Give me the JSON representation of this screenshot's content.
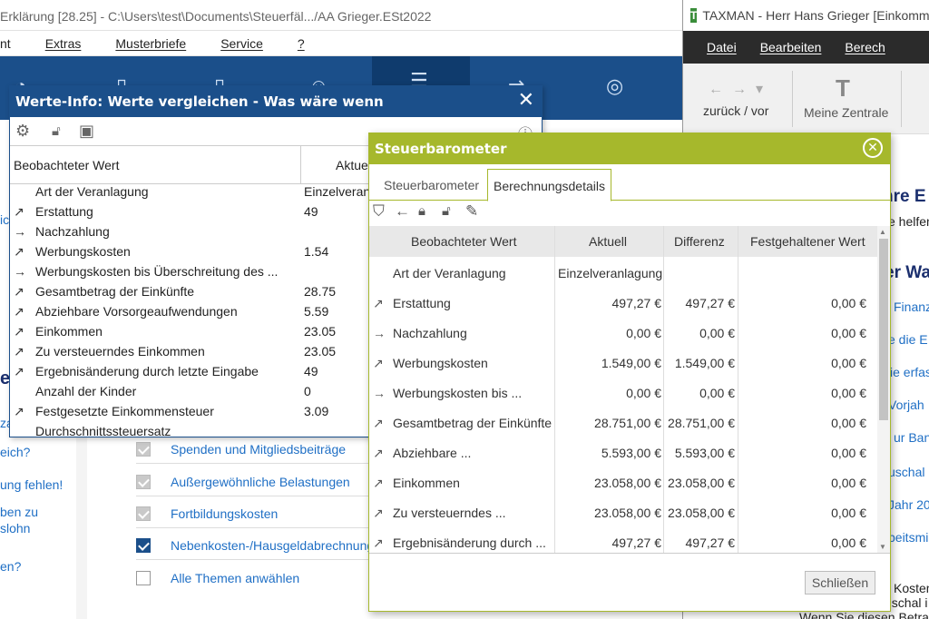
{
  "backwin": {
    "title": "Erklärung [28.25] - C:\\Users\\test\\Documents\\Steuerfäl.../AA Grieger.ESt2022",
    "menu": [
      "nt",
      "Extras",
      "Musterbriefe",
      "Service",
      "?"
    ],
    "left_links": [
      "ic.",
      "e",
      "eich?",
      "ung fehlen!",
      "ben zu",
      "slohn",
      "en?"
    ],
    "left_headings": [
      "er",
      "za"
    ],
    "check_items": [
      {
        "label": "Spenden und Mitgliedsbeiträge",
        "state": "checked-gray"
      },
      {
        "label": "Außergewöhnliche Belastungen",
        "state": "checked-gray"
      },
      {
        "label": "Fortbildungskosten",
        "state": "checked-gray"
      },
      {
        "label": "Nebenkosten-/Hausgeldabrechnung",
        "state": "checked-blue"
      },
      {
        "label": "Alle Themen anwählen",
        "state": "unchecked"
      }
    ]
  },
  "rightwin": {
    "title": "TAXMAN - Herr Hans Grieger [Einkomme",
    "menu": [
      "Datei",
      "Bearbeiten",
      "Berech"
    ],
    "nav_label": "zurück / vor",
    "home_label": "Meine Zentrale",
    "heading1": "hre E",
    "sub1": "e helfen",
    "heading2": "er Wa",
    "links": [
      "Finanz",
      "e die E",
      "ie erfas",
      "Vorjah",
      "ur Bank",
      "uschal",
      "Jahr 20",
      "beitsmi"
    ],
    "bottom_text": [
      "Kosten",
      "uschal i",
      "Wenn Sie diesen Betrag"
    ]
  },
  "werteinfo": {
    "title": "Werte-Info: Werte vergleichen - Was wäre wenn",
    "col_beobachtet": "Beobachteter Wert",
    "col_aktuell": "Aktuel",
    "rows": [
      {
        "arrow": "",
        "name": "Art der Veranlagung",
        "value": "Einzelveranl"
      },
      {
        "arrow": "↗",
        "name": "Erstattung",
        "value": "49"
      },
      {
        "arrow": "→",
        "name": "Nachzahlung",
        "value": ""
      },
      {
        "arrow": "↗",
        "name": "Werbungskosten",
        "value": "1.54"
      },
      {
        "arrow": "→",
        "name": "Werbungskosten bis Überschreitung des ...",
        "value": ""
      },
      {
        "arrow": "↗",
        "name": "Gesamtbetrag der Einkünfte",
        "value": "28.75"
      },
      {
        "arrow": "↗",
        "name": "Abziehbare Vorsorgeaufwendungen",
        "value": "5.59"
      },
      {
        "arrow": "↗",
        "name": "Einkommen",
        "value": "23.05"
      },
      {
        "arrow": "↗",
        "name": "Zu versteuerndes Einkommen",
        "value": "23.05"
      },
      {
        "arrow": "↗",
        "name": "Ergebnisänderung durch letzte Eingabe",
        "value": "49"
      },
      {
        "arrow": "",
        "name": "Anzahl der Kinder",
        "value": "0"
      },
      {
        "arrow": "↗",
        "name": "Festgesetzte Einkommensteuer",
        "value": "3.09"
      },
      {
        "arrow": "",
        "name": "Durchschnittssteuersatz",
        "value": ""
      }
    ]
  },
  "steuerbaro": {
    "title": "Steuerbarometer",
    "tabs": [
      "Steuerbarometer",
      "Berechnungsdetails"
    ],
    "active_tab": "Berechnungsdetails",
    "columns": [
      "Beobachteter Wert",
      "Aktuell",
      "Differenz",
      "Festgehaltener Wert"
    ],
    "rows": [
      {
        "arrow": "",
        "name": "Art der Veranlagung",
        "aktuell": "Einzelveranlagung",
        "differenz": "",
        "fest": ""
      },
      {
        "arrow": "↗",
        "name": "Erstattung",
        "aktuell": "497,27 €",
        "differenz": "497,27 €",
        "fest": "0,00 €"
      },
      {
        "arrow": "→",
        "name": "Nachzahlung",
        "aktuell": "0,00 €",
        "differenz": "0,00 €",
        "fest": "0,00 €"
      },
      {
        "arrow": "↗",
        "name": "Werbungskosten",
        "aktuell": "1.549,00 €",
        "differenz": "1.549,00 €",
        "fest": "0,00 €"
      },
      {
        "arrow": "→",
        "name": "Werbungskosten bis ...",
        "aktuell": "0,00 €",
        "differenz": "0,00 €",
        "fest": "0,00 €"
      },
      {
        "arrow": "↗",
        "name": "Gesamtbetrag der Einkünfte",
        "aktuell": "28.751,00 €",
        "differenz": "28.751,00 €",
        "fest": "0,00 €"
      },
      {
        "arrow": "↗",
        "name": "Abziehbare ...",
        "aktuell": "5.593,00 €",
        "differenz": "5.593,00 €",
        "fest": "0,00 €"
      },
      {
        "arrow": "↗",
        "name": "Einkommen",
        "aktuell": "23.058,00 €",
        "differenz": "23.058,00 €",
        "fest": "0,00 €"
      },
      {
        "arrow": "↗",
        "name": "Zu versteuerndes ...",
        "aktuell": "23.058,00 €",
        "differenz": "23.058,00 €",
        "fest": "0,00 €"
      },
      {
        "arrow": "↗",
        "name": "Ergebnisänderung durch ...",
        "aktuell": "497,27 €",
        "differenz": "497,27 €",
        "fest": "0,00 €"
      }
    ],
    "close_label": "Schließen"
  }
}
